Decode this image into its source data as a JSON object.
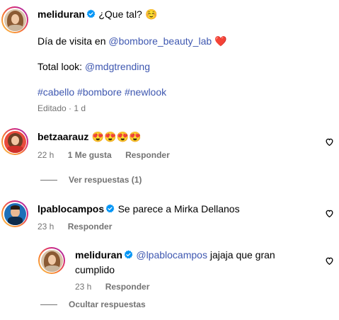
{
  "post": {
    "username": "meliduran",
    "greeting": "¿Que tal?",
    "greeting_emoji": "☺️",
    "line2_prefix": "Día de visita en ",
    "line2_mention": "@bombore_beauty_lab",
    "line2_emoji": "❤️",
    "line3_prefix": "Total look: ",
    "line3_mention": "@mdgtrending",
    "hashtags": "#cabello #bombore #newlook",
    "meta": "Editado · 1 d"
  },
  "comment1": {
    "username": "betzaarauz",
    "text": "😍😍😍😍",
    "time": "22 h",
    "likes": "1 Me gusta",
    "reply": "Responder",
    "view_replies": "Ver respuestas (1)"
  },
  "comment2": {
    "username": "lpablocampos",
    "text": "Se parece a Mirka Dellanos",
    "time": "23 h",
    "reply": "Responder"
  },
  "reply1": {
    "username": "meliduran",
    "mention": "@lpablocampos",
    "text_line1": " jajaja que gran",
    "text_line2": "cumplido",
    "time": "23 h",
    "reply": "Responder",
    "hide_replies": "Ocultar respuestas"
  },
  "colors": {
    "link": "#3e57b0",
    "verified": "#0095f6",
    "meta": "#737373"
  }
}
